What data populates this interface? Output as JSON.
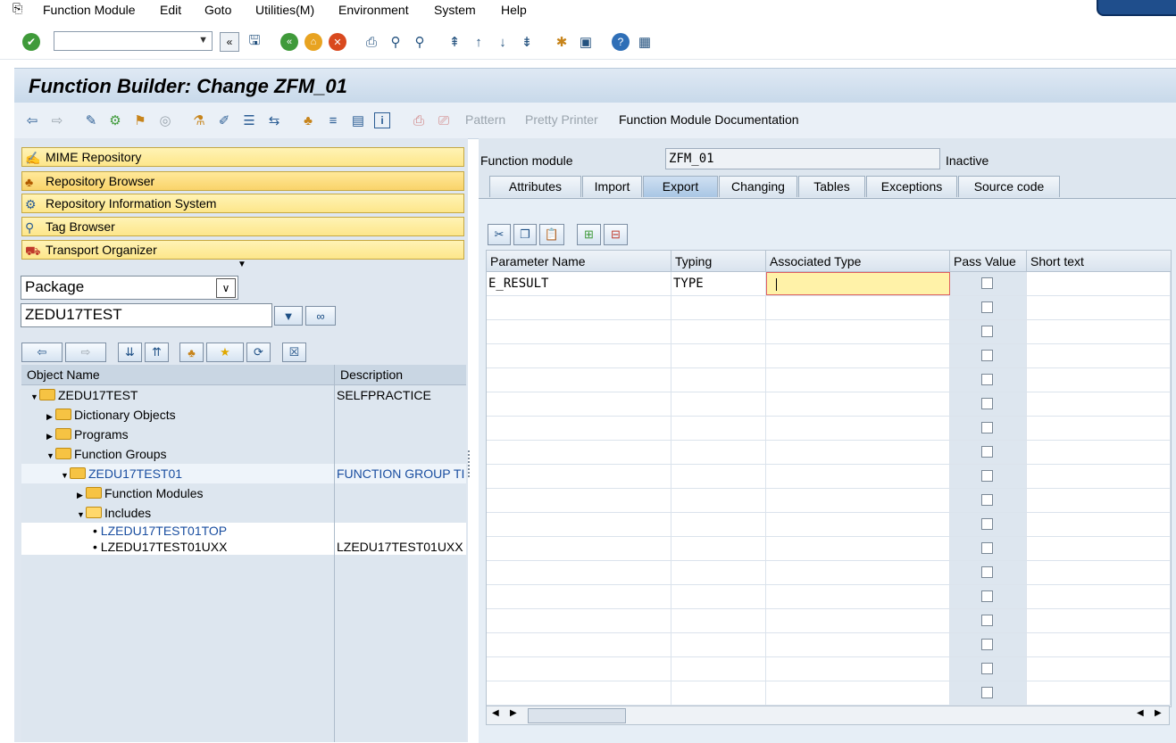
{
  "menu": {
    "items": [
      "Function Module",
      "Edit",
      "Goto",
      "Utilities(M)",
      "Environment",
      "System",
      "Help"
    ]
  },
  "title": "Function Builder: Change ZFM_01",
  "app_toolbar": {
    "pattern": "Pattern",
    "pretty_printer": "Pretty Printer",
    "documentation": "Function Module Documentation"
  },
  "nav_buttons": [
    "MIME Repository",
    "Repository Browser",
    "Repository Information System",
    "Tag Browser",
    "Transport Organizer"
  ],
  "object_type": "Package",
  "object_name": "ZEDU17TEST",
  "tree": {
    "col_object": "Object Name",
    "col_desc": "Description",
    "nodes": [
      {
        "label": "ZEDU17TEST",
        "desc": "SELFPRACTICE"
      },
      {
        "label": "Dictionary Objects",
        "desc": ""
      },
      {
        "label": "Programs",
        "desc": ""
      },
      {
        "label": "Function Groups",
        "desc": ""
      },
      {
        "label": "ZEDU17TEST01",
        "desc": "FUNCTION GROUP TI"
      },
      {
        "label": "Function Modules",
        "desc": ""
      },
      {
        "label": "Includes",
        "desc": ""
      },
      {
        "label": "LZEDU17TEST01TOP",
        "desc": ""
      },
      {
        "label": "LZEDU17TEST01UXX",
        "desc": "LZEDU17TEST01UXX"
      }
    ]
  },
  "function_module": {
    "label": "Function module",
    "value": "ZFM_01",
    "status": "Inactive"
  },
  "tabs": [
    "Attributes",
    "Import",
    "Export",
    "Changing",
    "Tables",
    "Exceptions",
    "Source code"
  ],
  "active_tab": "Export",
  "grid": {
    "columns": [
      "Parameter Name",
      "Typing",
      "Associated Type",
      "Pass Value",
      "Short text"
    ],
    "rows": [
      {
        "param": "E_RESULT",
        "typing": "TYPE",
        "assoc": "",
        "pass_value": false,
        "short_text": ""
      }
    ],
    "empty_rows": 17
  },
  "colors": {
    "title_bar": "#c8d9ea",
    "nav_button": "#fde68a",
    "active_tab": "#a9c6e4",
    "edit_cell": "#fff2a8"
  }
}
